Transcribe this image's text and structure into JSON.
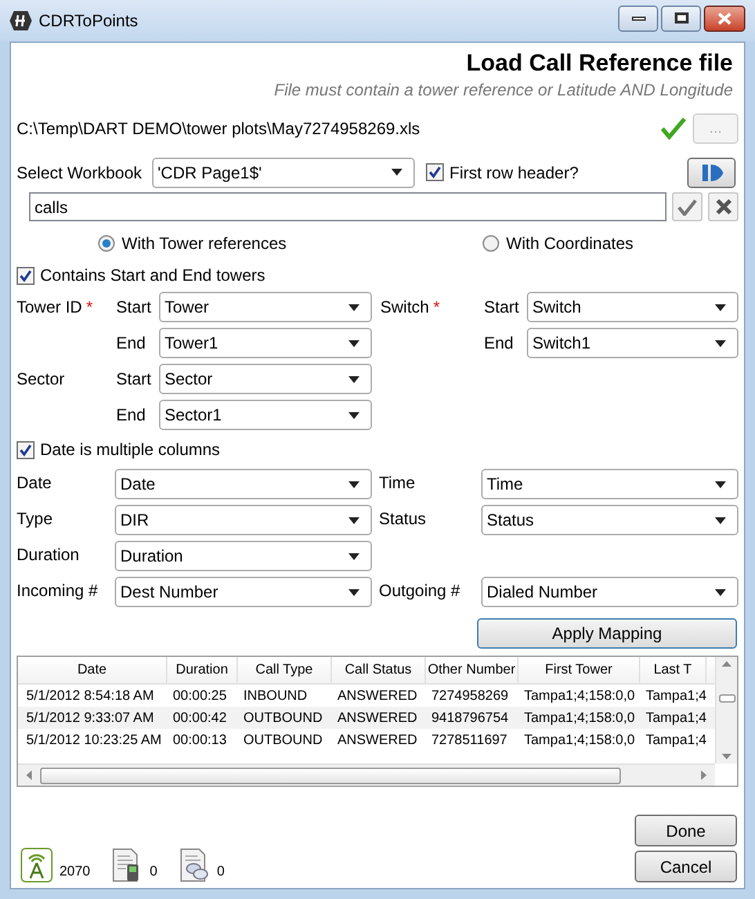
{
  "window": {
    "title": "CDRToPoints"
  },
  "header": {
    "title": "Load Call Reference file",
    "subtitle": "File must contain a tower reference or Latitude AND Longitude"
  },
  "file": {
    "path": "C:\\Temp\\DART DEMO\\tower plots\\May7274958269.xls",
    "valid": true,
    "browse_label": "..."
  },
  "workbook": {
    "label": "Select Workbook",
    "value": "'CDR Page1$'",
    "first_row_header": {
      "label": "First row header?",
      "checked": true
    }
  },
  "name_field": {
    "value": "calls"
  },
  "source_options": [
    {
      "label": "With Tower references",
      "selected": true
    },
    {
      "label": "With Coordinates",
      "selected": false
    }
  ],
  "towers": {
    "label": "Contains Start and End towers",
    "checked": true
  },
  "tower_fields": {
    "left": [
      {
        "label": "Tower ID",
        "required_mark": "*",
        "rows": [
          {
            "label": "Start",
            "value": "Tower"
          },
          {
            "label": "End",
            "value": "Tower1"
          }
        ]
      },
      {
        "label": "Sector",
        "rows": [
          {
            "label": "Start",
            "value": "Sector"
          },
          {
            "label": "End",
            "value": "Sector1"
          }
        ]
      }
    ],
    "right": [
      {
        "label": "Switch",
        "required_mark": "*",
        "rows": [
          {
            "label": "Start",
            "value": "Switch"
          },
          {
            "label": "End",
            "value": "Switch1"
          }
        ]
      }
    ]
  },
  "date_multi": {
    "label": "Date is multiple columns",
    "checked": true
  },
  "mapping_rows": [
    {
      "left": {
        "label": "Date",
        "value": "Date"
      },
      "right": {
        "label": "Time",
        "value": "Time"
      }
    },
    {
      "left": {
        "label": "Type",
        "value": "DIR"
      },
      "right": {
        "label": "Status",
        "value": "Status"
      }
    },
    {
      "left": {
        "label": "Duration",
        "value": "Duration"
      }
    },
    {
      "left": {
        "label": "Incoming #",
        "value": "Dest Number"
      },
      "right": {
        "label": "Outgoing #",
        "value": "Dialed Number"
      }
    }
  ],
  "apply_button": "Apply Mapping",
  "table": {
    "columns": [
      "Date",
      "Duration",
      "Call Type",
      "Call Status",
      "Other Number",
      "First Tower",
      "Last T"
    ],
    "rows": [
      [
        "5/1/2012 8:54:18 AM",
        "00:00:25",
        "INBOUND",
        "ANSWERED",
        "7274958269",
        "Tampa1;4;158:0,0",
        "Tampa1;4"
      ],
      [
        "5/1/2012 9:33:07 AM",
        "00:00:42",
        "OUTBOUND",
        "ANSWERED",
        "9418796754",
        "Tampa1;4;158:0,0",
        "Tampa1;4"
      ],
      [
        "5/1/2012 10:23:25 AM",
        "00:00:13",
        "OUTBOUND",
        "ANSWERED",
        "7278511697",
        "Tampa1;4;158:0,0",
        "Tampa1;4"
      ]
    ]
  },
  "buttons": [
    "Done",
    "Cancel"
  ],
  "status_bar": [
    {
      "kind": "tower",
      "value": "2070"
    },
    {
      "kind": "phone-doc",
      "value": "0"
    },
    {
      "kind": "chat-doc",
      "value": "0"
    }
  ]
}
